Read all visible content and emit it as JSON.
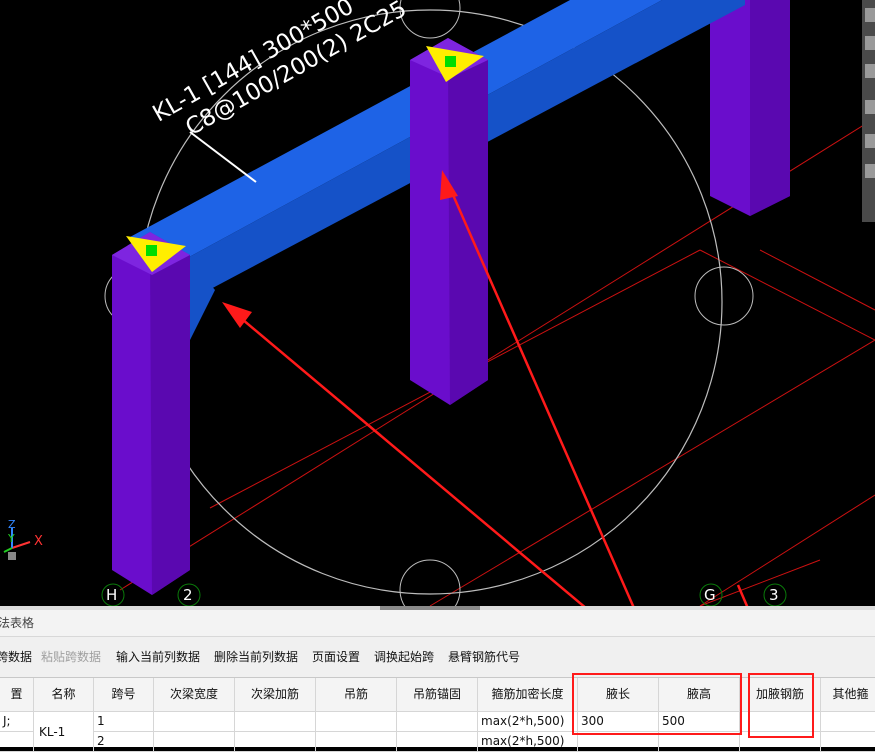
{
  "viewport": {
    "beam_annotation": {
      "line1": "KL-1 [144] 300*500",
      "line2": "C8@100/200(2) 2C25"
    },
    "axis_labels": [
      "H",
      "2",
      "G",
      "3"
    ],
    "axes": {
      "x": "X",
      "y": "Y",
      "z": "Z"
    }
  },
  "panel": {
    "title": "法表格",
    "toolbar": [
      {
        "label": "跨数据",
        "disabled": false
      },
      {
        "label": "粘贴跨数据",
        "disabled": true
      },
      {
        "label": "输入当前列数据",
        "disabled": false
      },
      {
        "label": "删除当前列数据",
        "disabled": false
      },
      {
        "label": "页面设置",
        "disabled": false
      },
      {
        "label": "调换起始跨",
        "disabled": false
      },
      {
        "label": "悬臂钢筋代号",
        "disabled": false
      }
    ],
    "columns": [
      "置",
      "名称",
      "跨号",
      "次梁宽度",
      "次梁加筋",
      "吊筋",
      "吊筋锚固",
      "箍筋加密长度",
      "腋长",
      "腋高",
      "加腋钢筋",
      "其他箍"
    ],
    "rows": [
      {
        "pos": "J;",
        "name": "KL-1",
        "span": "1",
        "stirrup_len": "max(2*h,500)",
        "haunch_len": "300",
        "haunch_height": "500",
        "haunch_rebar": ""
      },
      {
        "pos": "",
        "name": "",
        "span": "2",
        "stirrup_len": "max(2*h,500)",
        "haunch_len": "",
        "haunch_height": "",
        "haunch_rebar": ""
      }
    ]
  },
  "colors": {
    "beam": "#1a5fe0",
    "column": "#6a0dcc",
    "annotation_red": "#ff1a1a",
    "marker_yellow": "#ffee00",
    "marker_green": "#00dd00"
  }
}
